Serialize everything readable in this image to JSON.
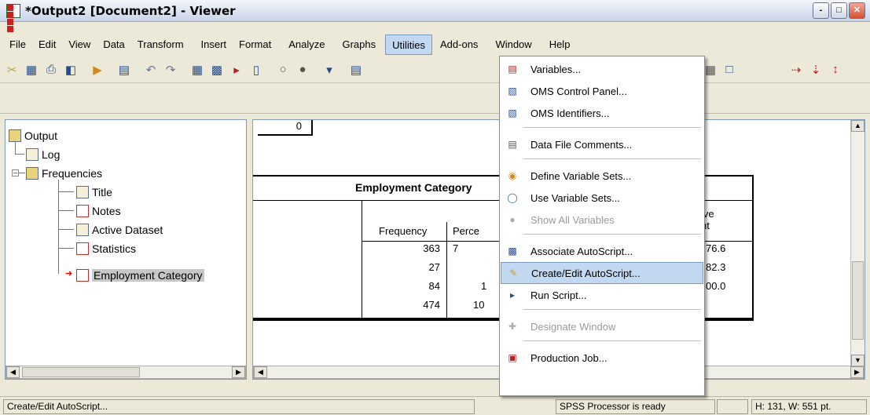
{
  "window": {
    "title": "*Output2 [Document2] - Viewer",
    "buttons": [
      "-",
      "□",
      "✕"
    ]
  },
  "menubar": {
    "items": [
      {
        "label": "File",
        "active": false
      },
      {
        "label": "Edit",
        "active": false
      },
      {
        "label": "View",
        "active": false
      },
      {
        "label": "Data",
        "active": false
      },
      {
        "label": "Transform",
        "active": false
      },
      {
        "label": "Insert",
        "active": false
      },
      {
        "label": "Format",
        "active": false
      },
      {
        "label": "Analyze",
        "active": false
      },
      {
        "label": "Graphs",
        "active": false
      },
      {
        "label": "Utilities",
        "active": true
      },
      {
        "label": "Add-ons",
        "active": false
      },
      {
        "label": "Window",
        "active": false
      },
      {
        "label": "Help",
        "active": false
      }
    ]
  },
  "outline": {
    "items": [
      {
        "label": "Output"
      },
      {
        "label": "Log"
      },
      {
        "label": "Frequencies"
      },
      {
        "label": "Title"
      },
      {
        "label": "Notes"
      },
      {
        "label": "Active Dataset"
      },
      {
        "label": "Statistics"
      },
      {
        "label": "Employment Category"
      }
    ]
  },
  "content": {
    "prev_value": "0",
    "table": {
      "title": "Employment Category",
      "col_frequency": "Frequency",
      "col_percent": "Perce",
      "col_cumulative": "ive",
      "col_cumulative2": "nt",
      "rows": [
        {
          "frequency": "363",
          "percent": "7",
          "cumulative": "76.6"
        },
        {
          "frequency": "27",
          "percent": "",
          "cumulative": "82.3"
        },
        {
          "frequency": "84",
          "percent": "1",
          "cumulative": "00.0"
        },
        {
          "frequency": "474",
          "percent": "10",
          "cumulative": ""
        }
      ]
    }
  },
  "utilities_menu": {
    "items": [
      {
        "label": "Variables...",
        "icon": "variables-icon",
        "disabled": false,
        "highlighted": false
      },
      {
        "label": "OMS Control Panel...",
        "icon": "oms-control-icon",
        "disabled": false,
        "highlighted": false
      },
      {
        "label": "OMS Identifiers...",
        "icon": "oms-identifiers-icon",
        "disabled": false,
        "highlighted": false
      },
      {
        "label": "Data File Comments...",
        "icon": "comments-icon",
        "disabled": false,
        "highlighted": false
      },
      {
        "label": "Define Variable Sets...",
        "icon": "define-sets-icon",
        "disabled": false,
        "highlighted": false
      },
      {
        "label": "Use Variable Sets...",
        "icon": "use-sets-icon",
        "disabled": false,
        "highlighted": false
      },
      {
        "label": "Show All Variables",
        "icon": "show-all-icon",
        "disabled": true,
        "highlighted": false
      },
      {
        "label": "Associate AutoScript...",
        "icon": "associate-icon",
        "disabled": false,
        "highlighted": false
      },
      {
        "label": "Create/Edit AutoScript...",
        "icon": "create-edit-icon",
        "disabled": false,
        "highlighted": true
      },
      {
        "label": "Run Script...",
        "icon": "run-script-icon",
        "disabled": false,
        "highlighted": false
      },
      {
        "label": "Designate Window",
        "icon": "designate-icon",
        "disabled": true,
        "highlighted": false
      },
      {
        "label": "Production Job...",
        "icon": "production-job-icon",
        "disabled": false,
        "highlighted": false
      }
    ]
  },
  "statusbar": {
    "message": "Create/Edit AutoScript...",
    "processor": "SPSS  Processor is ready",
    "dimensions": "H: 131, W: 551 pt."
  },
  "colors": {
    "highlight": "#c2d7f0",
    "chrome": "#ece9d8",
    "border": "#7f9db9"
  }
}
